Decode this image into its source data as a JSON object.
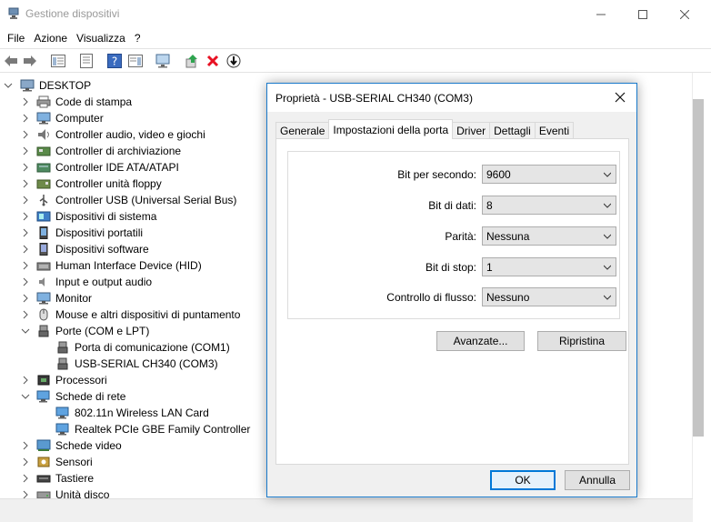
{
  "window": {
    "title": "Gestione dispositivi"
  },
  "menu": [
    "File",
    "Azione",
    "Visualizza",
    "?"
  ],
  "tree": {
    "root": "DESKTOP",
    "items": [
      {
        "label": "Code di stampa",
        "icon": "printer-icon",
        "expanded": false
      },
      {
        "label": "Computer",
        "icon": "monitor-icon",
        "expanded": false
      },
      {
        "label": "Controller audio, video e giochi",
        "icon": "speaker-icon",
        "expanded": false
      },
      {
        "label": "Controller di archiviazione",
        "icon": "storage-controller-icon",
        "expanded": false
      },
      {
        "label": "Controller IDE ATA/ATAPI",
        "icon": "ide-controller-icon",
        "expanded": false
      },
      {
        "label": "Controller unità floppy",
        "icon": "floppy-controller-icon",
        "expanded": false
      },
      {
        "label": "Controller USB (Universal Serial Bus)",
        "icon": "usb-icon",
        "expanded": false
      },
      {
        "label": "Dispositivi di sistema",
        "icon": "system-device-icon",
        "expanded": false
      },
      {
        "label": "Dispositivi portatili",
        "icon": "portable-device-icon",
        "expanded": false
      },
      {
        "label": "Dispositivi software",
        "icon": "software-device-icon",
        "expanded": false
      },
      {
        "label": "Human Interface Device (HID)",
        "icon": "hid-icon",
        "expanded": false
      },
      {
        "label": "Input e output audio",
        "icon": "audio-io-icon",
        "expanded": false
      },
      {
        "label": "Monitor",
        "icon": "monitor-icon",
        "expanded": false
      },
      {
        "label": "Mouse e altri dispositivi di puntamento",
        "icon": "mouse-icon",
        "expanded": false
      },
      {
        "label": "Porte (COM e LPT)",
        "icon": "port-icon",
        "expanded": true
      },
      {
        "label": "Porta di comunicazione (COM1)",
        "icon": "port-icon",
        "child": true
      },
      {
        "label": "USB-SERIAL CH340 (COM3)",
        "icon": "port-icon",
        "child": true
      },
      {
        "label": "Processori",
        "icon": "processor-icon",
        "expanded": false
      },
      {
        "label": "Schede di rete",
        "icon": "network-icon",
        "expanded": true
      },
      {
        "label": "802.11n Wireless LAN Card",
        "icon": "network-icon",
        "child": true
      },
      {
        "label": "Realtek PCIe GBE Family Controller",
        "icon": "network-icon",
        "child": true
      },
      {
        "label": "Schede video",
        "icon": "display-adapter-icon",
        "expanded": false
      },
      {
        "label": "Sensori",
        "icon": "sensor-icon",
        "expanded": false
      },
      {
        "label": "Tastiere",
        "icon": "keyboard-icon",
        "expanded": false
      },
      {
        "label": "Unità disco",
        "icon": "disk-icon",
        "expanded": false
      }
    ]
  },
  "dialog": {
    "title": "Proprietà - USB-SERIAL CH340 (COM3)",
    "tabs": [
      "Generale",
      "Impostazioni della porta",
      "Driver",
      "Dettagli",
      "Eventi"
    ],
    "active_tab": "Impostazioni della porta",
    "fields": [
      {
        "label": "Bit per secondo:",
        "value": "9600"
      },
      {
        "label": "Bit di dati:",
        "value": "8"
      },
      {
        "label": "Parità:",
        "value": "Nessuna"
      },
      {
        "label": "Bit di stop:",
        "value": "1"
      },
      {
        "label": "Controllo di flusso:",
        "value": "Nessuno"
      }
    ],
    "buttons": {
      "advanced": "Avanzate...",
      "restore": "Ripristina",
      "ok": "OK",
      "cancel": "Annulla"
    }
  },
  "colors": {
    "accent": "#0078d7",
    "dialog_border": "#1979ca",
    "delete_red": "#e81123"
  }
}
